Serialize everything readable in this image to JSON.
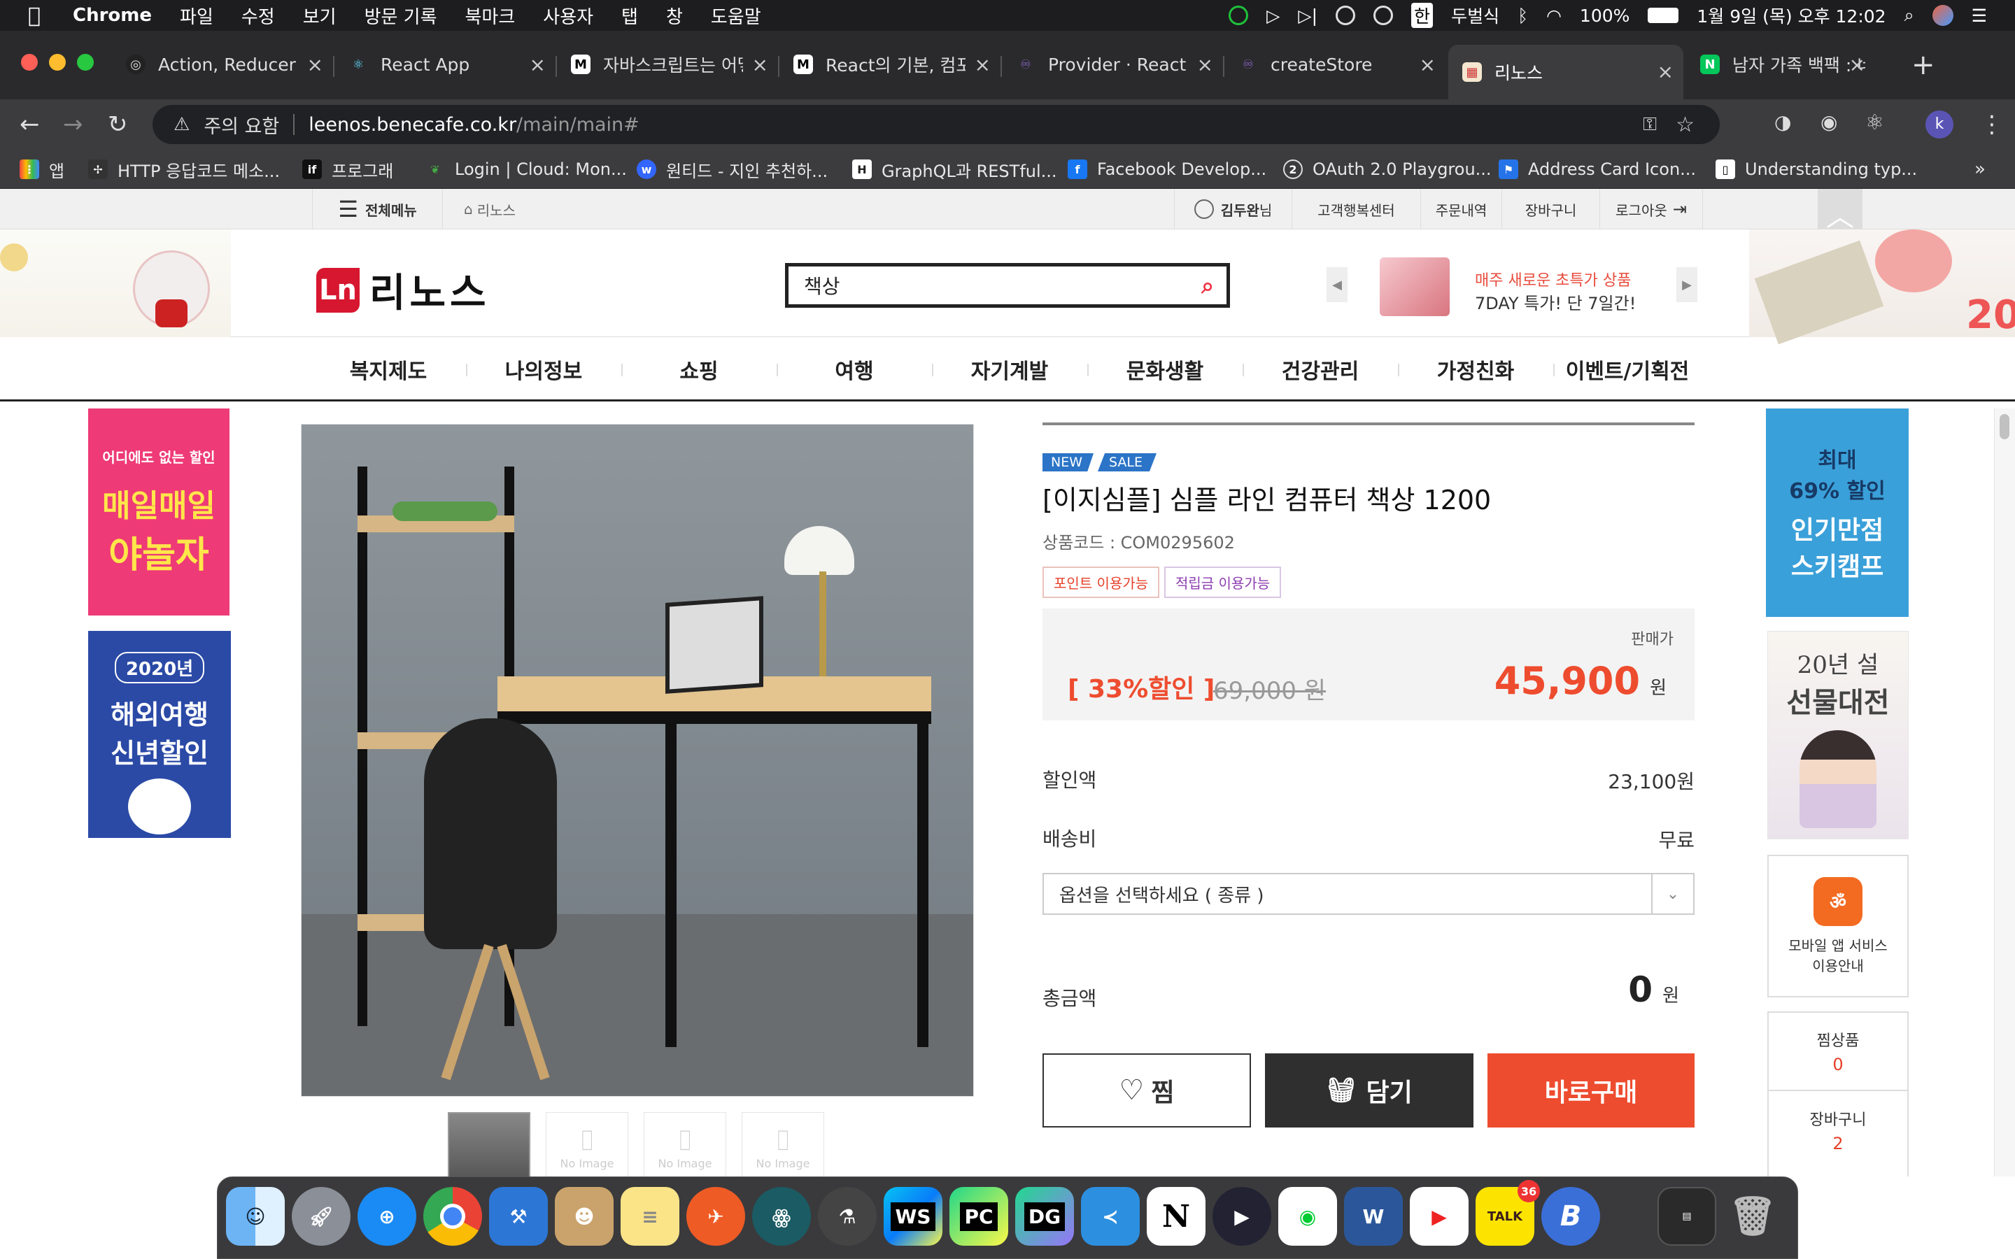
{
  "menubar": {
    "app": "Chrome",
    "items": [
      "파일",
      "수정",
      "보기",
      "방문 기록",
      "북마크",
      "사용자",
      "탭",
      "창",
      "도움말"
    ],
    "user": "두벌식",
    "battery": "100%",
    "clock": "1월 9일 (목) 오후 12:02"
  },
  "tabs": [
    {
      "title": "Action, Reducer w",
      "icon": "github-icon",
      "active": false
    },
    {
      "title": "React App",
      "icon": "react-icon",
      "active": false
    },
    {
      "title": "자바스크립트는 어떻",
      "icon": "medium-icon",
      "active": false
    },
    {
      "title": "React의 기본, 컴포",
      "icon": "medium-icon",
      "active": false
    },
    {
      "title": "Provider · React R",
      "icon": "redux-icon",
      "active": false
    },
    {
      "title": "createStore",
      "icon": "redux-icon",
      "active": false
    },
    {
      "title": "리노스",
      "icon": "leenos-icon",
      "active": true
    },
    {
      "title": "남자 가족 백팩 : 네이",
      "icon": "naver-icon",
      "active": false
    }
  ],
  "address": {
    "warning": "주의 요함",
    "host": "leenos.benecafe.co.kr",
    "path": "/main/main#",
    "profile_letter": "k"
  },
  "bookmarks": [
    {
      "label": "앱",
      "icon": "apps-icon"
    },
    {
      "label": "HTTP 응답코드 메소...",
      "icon": "http-icon"
    },
    {
      "label": "프로그래",
      "icon": "if-icon"
    },
    {
      "label": "Login | Cloud: Mon...",
      "icon": "mongo-icon"
    },
    {
      "label": "원티드 - 지인 추천하...",
      "icon": "wanted-icon"
    },
    {
      "label": "GraphQL과 RESTful...",
      "icon": "graphql-icon"
    },
    {
      "label": "Facebook Develop...",
      "icon": "facebook-icon"
    },
    {
      "label": "OAuth 2.0 Playgrou...",
      "icon": "oauth-icon"
    },
    {
      "label": "Address Card Icon...",
      "icon": "flag-icon"
    },
    {
      "label": "Understanding typ...",
      "icon": "doc-icon"
    }
  ],
  "site": {
    "topnav": {
      "all_menu": "전체메뉴",
      "home": "리노스",
      "user_name": "김두완",
      "user_suffix": "님",
      "links": [
        "고객행복센터",
        "주문내역",
        "장바구니",
        "로그아웃"
      ]
    },
    "logo": "리노스",
    "search_value": "책상",
    "promo_line1": "매주 새로운 초특가 상품",
    "promo_line2": "7DAY 특가! 단 7일간!",
    "gnb": [
      "복지제도",
      "나의정보",
      "쇼핑",
      "여행",
      "자기계발",
      "문화생활",
      "건강관리",
      "가정친화",
      "이벤트/기획전"
    ]
  },
  "left_banners": [
    {
      "line1": "어디에도 없는 할인",
      "line2": "매일매일",
      "line3": "야놀자"
    },
    {
      "line1": "2020년",
      "line2": "해외여행",
      "line3": "신년할인"
    }
  ],
  "right_banners": {
    "ski": {
      "line1": "최대",
      "line2": "69% 할인",
      "line3": "인기만점",
      "line4": "스키캠프"
    },
    "gift": {
      "line1": "20년 설",
      "line2": "선물대전"
    },
    "app": {
      "line1": "모바일 앱 서비스",
      "line2": "이용안내"
    },
    "wish_label": "찜상품",
    "wish_count": "0",
    "cart_label": "장바구니",
    "cart_count": "2"
  },
  "product": {
    "badges": [
      "NEW",
      "SALE"
    ],
    "name": "[이지심플] 심플 라인 컴퓨터 책상 1200",
    "code": "상품코드 : COM0295602",
    "tags": [
      "포인트 이용가능",
      "적립금 이용가능"
    ],
    "price_label": "판매가",
    "discount": "[ 33%할인 ]",
    "original_price": "69,000 원",
    "sale_price": "45,900",
    "won": "원",
    "discount_amount_label": "할인액",
    "discount_amount": "23,100원",
    "shipping_label": "배송비",
    "shipping": "무료",
    "option_placeholder": "옵션을 선택하세요 ( 종류 )",
    "total_label": "총금액",
    "total": "0",
    "buttons": {
      "wish": "찜",
      "cart": "담기",
      "buy": "바로구매"
    },
    "thumb_noimage": "No Image"
  },
  "dock": [
    "Finder",
    "Launchpad",
    "Safari",
    "Chrome",
    "Xcode",
    "Contacts",
    "Notes",
    "Postman",
    "GitKraken",
    "Lab",
    "WS",
    "PC",
    "DG",
    "VS Code",
    "Notion",
    "Infuse",
    "Line",
    "Word",
    "YouTube",
    "KakaoTalk",
    "B",
    "Terminal",
    "Trash"
  ],
  "dock_badge": "36",
  "colors": {
    "accent": "#ee4c2f",
    "brand_red": "#d7172f",
    "dark": "#2f2f2f",
    "badge_blue": "#2b74c7"
  }
}
